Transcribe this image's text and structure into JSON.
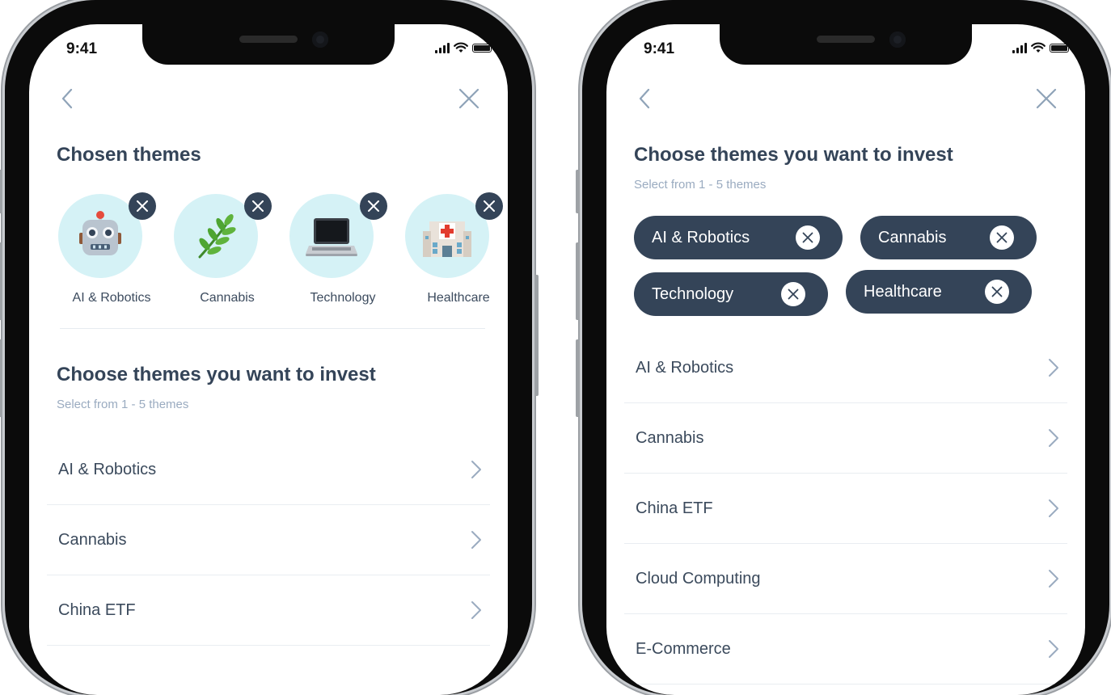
{
  "status_bar": {
    "time": "9:41"
  },
  "left_screen": {
    "chosen_title": "Chosen themes",
    "chosen_themes": [
      {
        "label": "AI & Robotics",
        "icon": "robot-icon"
      },
      {
        "label": "Cannabis",
        "icon": "herb-icon"
      },
      {
        "label": "Technology",
        "icon": "laptop-icon"
      },
      {
        "label": "Healthcare",
        "icon": "hospital-icon"
      }
    ],
    "choose_title": "Choose themes you want to invest",
    "choose_subtitle": "Select from 1 - 5 themes",
    "list": [
      "AI & Robotics",
      "Cannabis",
      "China ETF"
    ]
  },
  "right_screen": {
    "choose_title": "Choose themes you want to invest",
    "choose_subtitle": "Select from 1 - 5 themes",
    "chips": [
      "AI & Robotics",
      "Cannabis",
      "Technology",
      "Healthcare"
    ],
    "list": [
      "AI & Robotics",
      "Cannabis",
      "China ETF",
      "Cloud Computing",
      "E-Commerce"
    ]
  },
  "colors": {
    "primary": "#344458",
    "circle_bg": "#d5f2f6",
    "subtitle": "#9aabc0",
    "nav_icon": "#8fa3b8"
  }
}
